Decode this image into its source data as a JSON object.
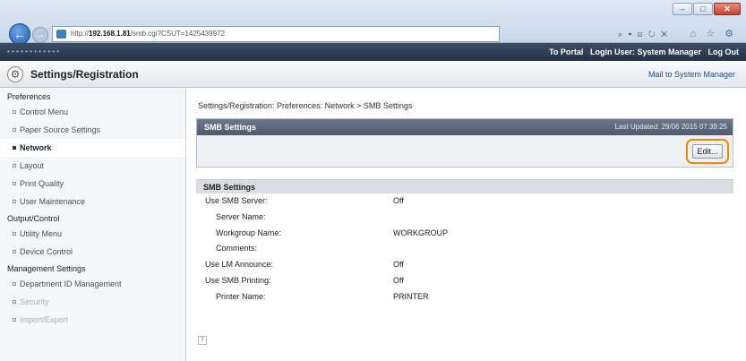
{
  "browser": {
    "url_prefix": "http://",
    "url_host": "192.168.1.81",
    "url_rest": "/smb.cgi?CSUT=1425439972",
    "addr_tools": "⌕ ▾ ⊡ ↻ ✕",
    "win_min": "–",
    "win_max": "□",
    "win_close": "✕",
    "back_arrow": "←",
    "forward_arrow": "→",
    "ie_icons": "⌂ ☆ ⚙"
  },
  "topbar": {
    "left_text": "• • • • • • • • • • • •",
    "to_portal": "To Portal",
    "login_user": "Login User: System Manager",
    "logout": "Log Out"
  },
  "titlebar": {
    "title": "Settings/Registration",
    "mail": "Mail to System Manager"
  },
  "sidebar": {
    "preferences": "Preferences",
    "output_control": "Output/Control",
    "management": "Management Settings",
    "items_pref": [
      "Control Menu",
      "Paper Source Settings",
      "Network",
      "Layout",
      "Print Quality",
      "User Maintenance"
    ],
    "items_output": [
      "Utility Menu",
      "Device Control"
    ],
    "items_mgmt": [
      "Department ID Management",
      "Security",
      "Import/Export"
    ]
  },
  "main": {
    "breadcrumb": "Settings/Registration: Preferences: Network > SMB Settings",
    "panel_title": "SMB Settings",
    "last_updated": "Last Updated: 29/06 2015 07:39:25",
    "edit_label": "Edit...",
    "section_title": "SMB Settings",
    "rows": [
      {
        "label": "Use SMB Server:",
        "value": "Off",
        "indent": false
      },
      {
        "label": "Server Name:",
        "value": "",
        "indent": true
      },
      {
        "label": "Workgroup Name:",
        "value": "WORKGROUP",
        "indent": true
      },
      {
        "label": "Comments:",
        "value": "",
        "indent": true
      },
      {
        "label": "Use LM Announce:",
        "value": "Off",
        "indent": false
      },
      {
        "label": "Use SMB Printing:",
        "value": "Off",
        "indent": false
      },
      {
        "label": "Printer Name:",
        "value": "PRINTER",
        "indent": true
      }
    ]
  }
}
